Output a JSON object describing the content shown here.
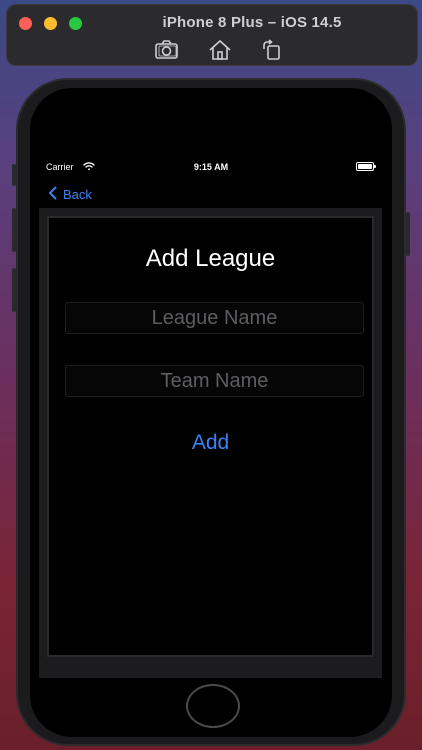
{
  "simulator": {
    "title": "iPhone 8 Plus – iOS 14.5",
    "toolbar_icons": [
      "screenshot-icon",
      "home-icon",
      "rotate-icon"
    ]
  },
  "status_bar": {
    "carrier": "Carrier",
    "time": "9:15 AM"
  },
  "nav": {
    "back_label": "Back"
  },
  "form": {
    "title": "Add League",
    "league_name": {
      "value": "",
      "placeholder": "League Name"
    },
    "team_name": {
      "value": "",
      "placeholder": "Team Name"
    },
    "add_label": "Add"
  },
  "colors": {
    "accent": "#3b82f6",
    "screen_background": "#000000"
  }
}
